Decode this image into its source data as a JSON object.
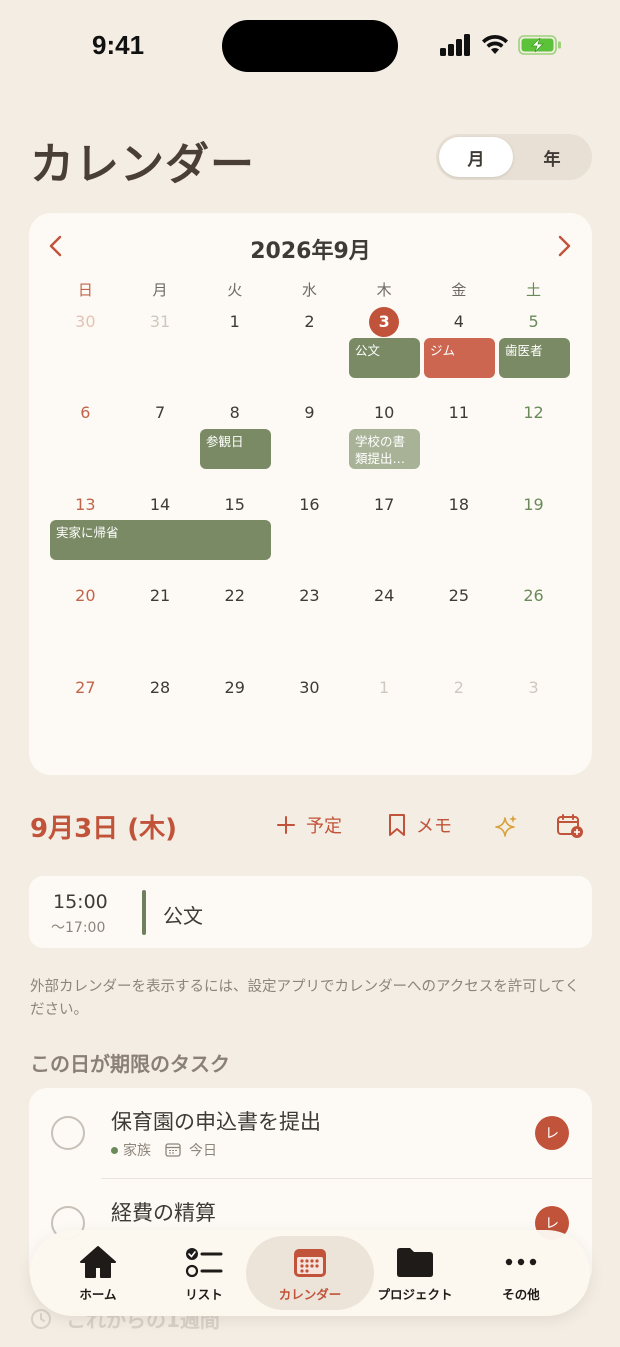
{
  "status_bar": {
    "time": "9:41"
  },
  "header": {
    "title": "カレンダー",
    "view_options": [
      "月",
      "年"
    ],
    "selected_view": "月"
  },
  "calendar": {
    "month_title": "2026年9月",
    "weekdays": [
      "日",
      "月",
      "火",
      "水",
      "木",
      "金",
      "土"
    ],
    "weeks": [
      [
        "30",
        "31",
        "1",
        "2",
        "3",
        "4",
        "5"
      ],
      [
        "6",
        "7",
        "8",
        "9",
        "10",
        "11",
        "12"
      ],
      [
        "13",
        "14",
        "15",
        "16",
        "17",
        "18",
        "19"
      ],
      [
        "20",
        "21",
        "22",
        "23",
        "24",
        "25",
        "26"
      ],
      [
        "27",
        "28",
        "29",
        "30",
        "1",
        "2",
        "3"
      ]
    ],
    "today": "3",
    "events": [
      {
        "label": "公文",
        "color": "#7a8a64"
      },
      {
        "label": "ジム",
        "color": "#cc6650"
      },
      {
        "label": "歯医者",
        "color": "#7a8a64"
      },
      {
        "label": "参観日",
        "color": "#7a8a64"
      },
      {
        "label": "学校の書類提出…",
        "color": "#a7b296"
      },
      {
        "label": "実家に帰省",
        "color": "#7a8a64"
      }
    ]
  },
  "selected_day": {
    "date_label": "9月3日 (木)",
    "add_event_label": "予定",
    "memo_label": "メモ"
  },
  "day_events": [
    {
      "start": "15:00",
      "end": "～17:00",
      "title": "公文"
    }
  ],
  "notice": "外部カレンダーを表示するには、設定アプリでカレンダーへのアクセスを許可してください。",
  "tasks_section": {
    "title": "この日が期限のタスク",
    "tasks": [
      {
        "title": "保育園の申込書を提出",
        "list": "家族",
        "due": "今日",
        "assignee": "レ"
      },
      {
        "title": "経費の精算",
        "assignee": "レ"
      }
    ]
  },
  "upcoming_label": "これからの1週間",
  "tabbar": {
    "items": [
      {
        "label": "ホーム",
        "icon": "home-icon"
      },
      {
        "label": "リスト",
        "icon": "list-icon"
      },
      {
        "label": "カレンダー",
        "icon": "calendar-icon"
      },
      {
        "label": "プロジェクト",
        "icon": "folder-icon"
      },
      {
        "label": "その他",
        "icon": "more-icon"
      }
    ],
    "active": "カレンダー"
  },
  "colors": {
    "accent": "#c1533a",
    "background": "#f4ede3",
    "card": "#fdfaf5",
    "event_green": "#7a8a64",
    "event_red": "#cc6650",
    "saturday": "#6b8a5a"
  }
}
